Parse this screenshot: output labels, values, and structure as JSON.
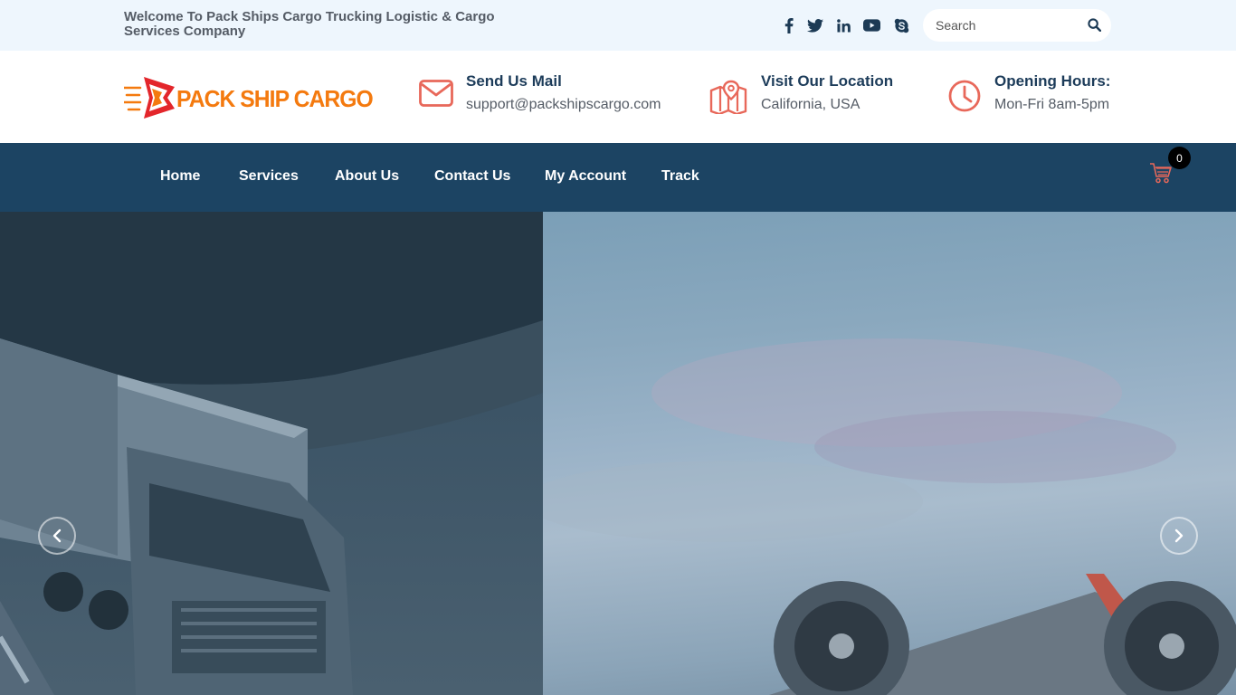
{
  "topbar": {
    "welcome": "Welcome To Pack Ships Cargo Trucking Logistic & Cargo Services Company",
    "social": [
      "facebook-icon",
      "twitter-icon",
      "linkedin-icon",
      "youtube-icon",
      "skype-icon"
    ],
    "search": {
      "placeholder": "Search",
      "value": ""
    }
  },
  "header": {
    "logo_text": "PACK SHIP CARGO",
    "info": [
      {
        "icon": "mail-icon",
        "title": "Send Us Mail",
        "text": "support@packshipscargo.com"
      },
      {
        "icon": "map-icon",
        "title": "Visit Our Location",
        "text": "California, USA"
      },
      {
        "icon": "clock-icon",
        "title": "Opening Hours:",
        "text": "Mon-Fri 8am-5pm"
      }
    ]
  },
  "nav": {
    "items": [
      "Home",
      "Services",
      "About Us",
      "Contact Us",
      "My Account",
      "Track"
    ],
    "cart_count": "0"
  },
  "colors": {
    "topbar_bg": "#eef6fd",
    "navbar_bg": "#1c4463",
    "heading": "#1d3c5a",
    "accent": "#e8685a",
    "logo_orange": "#f47a0f",
    "logo_red": "#e3262b"
  }
}
